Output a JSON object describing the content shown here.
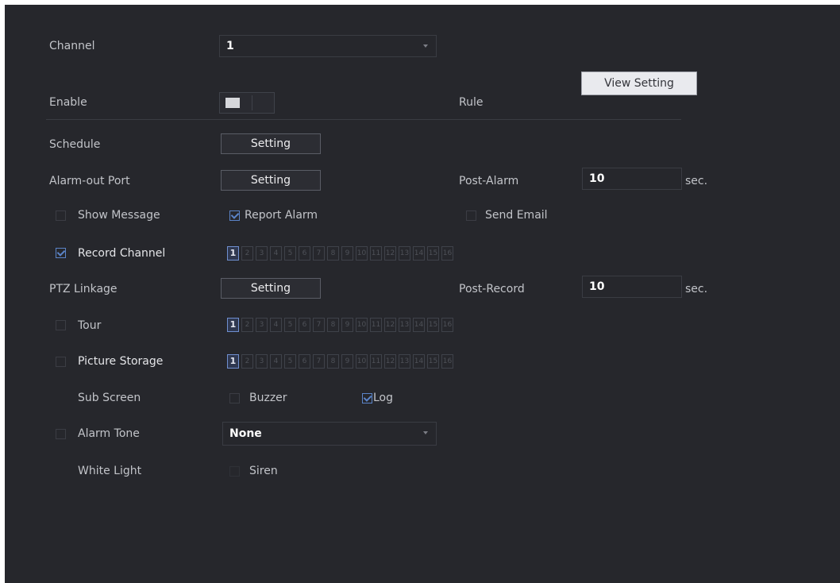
{
  "channel": {
    "label": "Channel",
    "value": "1"
  },
  "enable": {
    "label": "Enable",
    "state": "on"
  },
  "rule": {
    "label": "Rule",
    "button": "View Setting"
  },
  "schedule": {
    "label": "Schedule",
    "button": "Setting"
  },
  "alarm_out": {
    "label": "Alarm-out Port",
    "button": "Setting"
  },
  "post_alarm": {
    "label": "Post-Alarm",
    "value": "10",
    "unit": "sec."
  },
  "show_message": {
    "label": "Show Message",
    "checked": false
  },
  "report_alarm": {
    "label": "Report Alarm",
    "checked": true
  },
  "send_email": {
    "label": "Send Email",
    "checked": false
  },
  "record_channel": {
    "label": "Record Channel",
    "checked": true,
    "channels": [
      "1",
      "2",
      "3",
      "4",
      "5",
      "6",
      "7",
      "8",
      "9",
      "10",
      "11",
      "12",
      "13",
      "14",
      "15",
      "16"
    ],
    "selected": [
      "1"
    ]
  },
  "ptz": {
    "label": "PTZ Linkage",
    "button": "Setting"
  },
  "post_record": {
    "label": "Post-Record",
    "value": "10",
    "unit": "sec."
  },
  "tour": {
    "label": "Tour",
    "checked": false,
    "channels": [
      "1",
      "2",
      "3",
      "4",
      "5",
      "6",
      "7",
      "8",
      "9",
      "10",
      "11",
      "12",
      "13",
      "14",
      "15",
      "16"
    ],
    "selected": [
      "1"
    ]
  },
  "picture_storage": {
    "label": "Picture Storage",
    "checked": false,
    "channels": [
      "1",
      "2",
      "3",
      "4",
      "5",
      "6",
      "7",
      "8",
      "9",
      "10",
      "11",
      "12",
      "13",
      "14",
      "15",
      "16"
    ],
    "selected": [
      "1"
    ]
  },
  "sub_screen": {
    "label": "Sub Screen"
  },
  "buzzer": {
    "label": "Buzzer",
    "checked": false
  },
  "log": {
    "label": "Log",
    "checked": true
  },
  "alarm_tone": {
    "label": "Alarm Tone",
    "checked": false,
    "value": "None"
  },
  "white_light": {
    "label": "White Light"
  },
  "siren": {
    "label": "Siren",
    "checked": false
  },
  "colors": {
    "background": "#26272c",
    "accent": "#5b84c8",
    "text": "#c2c4c9"
  }
}
